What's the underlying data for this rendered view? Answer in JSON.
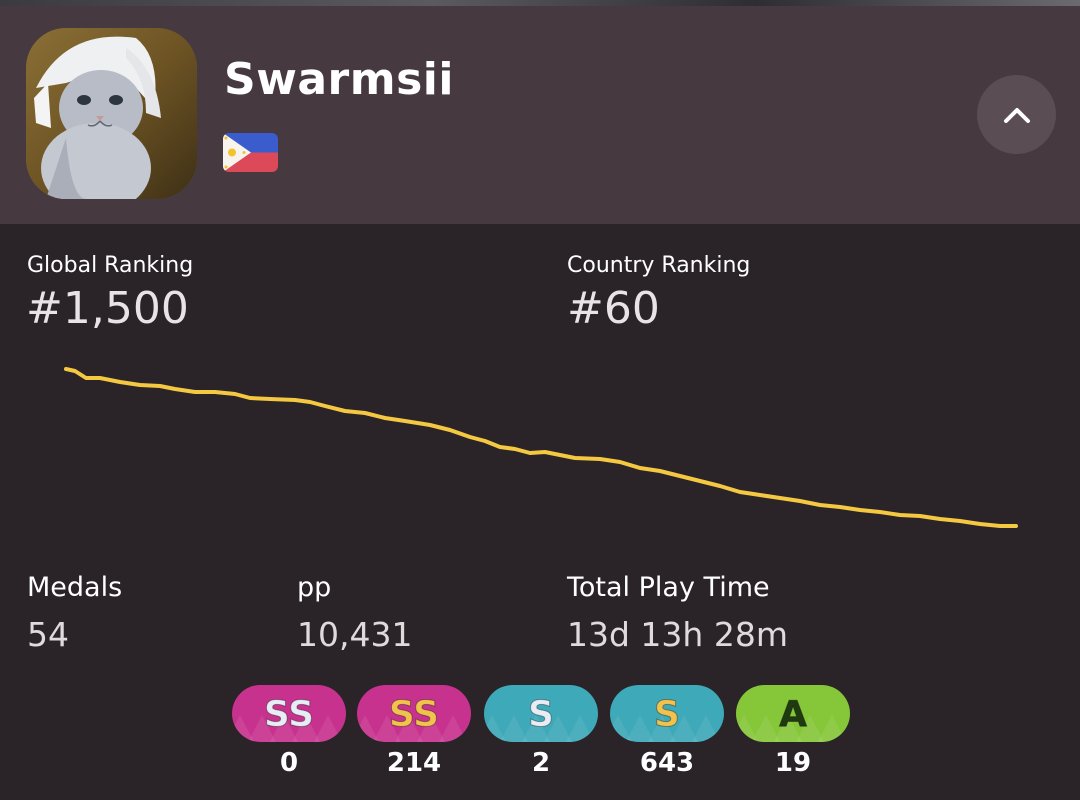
{
  "profile": {
    "username": "Swarmsii",
    "country_flag": "flag-philippines-icon"
  },
  "rankings": {
    "global_label": "Global Ranking",
    "global_value": "#1,500",
    "country_label": "Country Ranking",
    "country_value": "#60"
  },
  "stats": {
    "medals_label": "Medals",
    "medals_value": "54",
    "pp_label": "pp",
    "pp_value": "10,431",
    "playtime_label": "Total Play Time",
    "playtime_value": "13d 13h 28m"
  },
  "grades": [
    {
      "icon": "grade-ss-silver-icon",
      "letter": "SS",
      "count": "0",
      "bg": "#c7328f",
      "text": "#e8ecf4"
    },
    {
      "icon": "grade-ss-gold-icon",
      "letter": "SS",
      "count": "214",
      "bg": "#c7328f",
      "text": "#f1c24e"
    },
    {
      "icon": "grade-s-silver-icon",
      "letter": "S",
      "count": "2",
      "bg": "#3ea9b8",
      "text": "#e8ecf4"
    },
    {
      "icon": "grade-s-gold-icon",
      "letter": "S",
      "count": "643",
      "bg": "#3ea9b8",
      "text": "#f1c24e"
    },
    {
      "icon": "grade-a-icon",
      "letter": "A",
      "count": "19",
      "bg": "#86c73a",
      "text": "#1f3a10"
    }
  ],
  "colors": {
    "header_bg": "#463a40",
    "body_bg": "#2a2328",
    "rank_line": "#f5c842"
  }
}
